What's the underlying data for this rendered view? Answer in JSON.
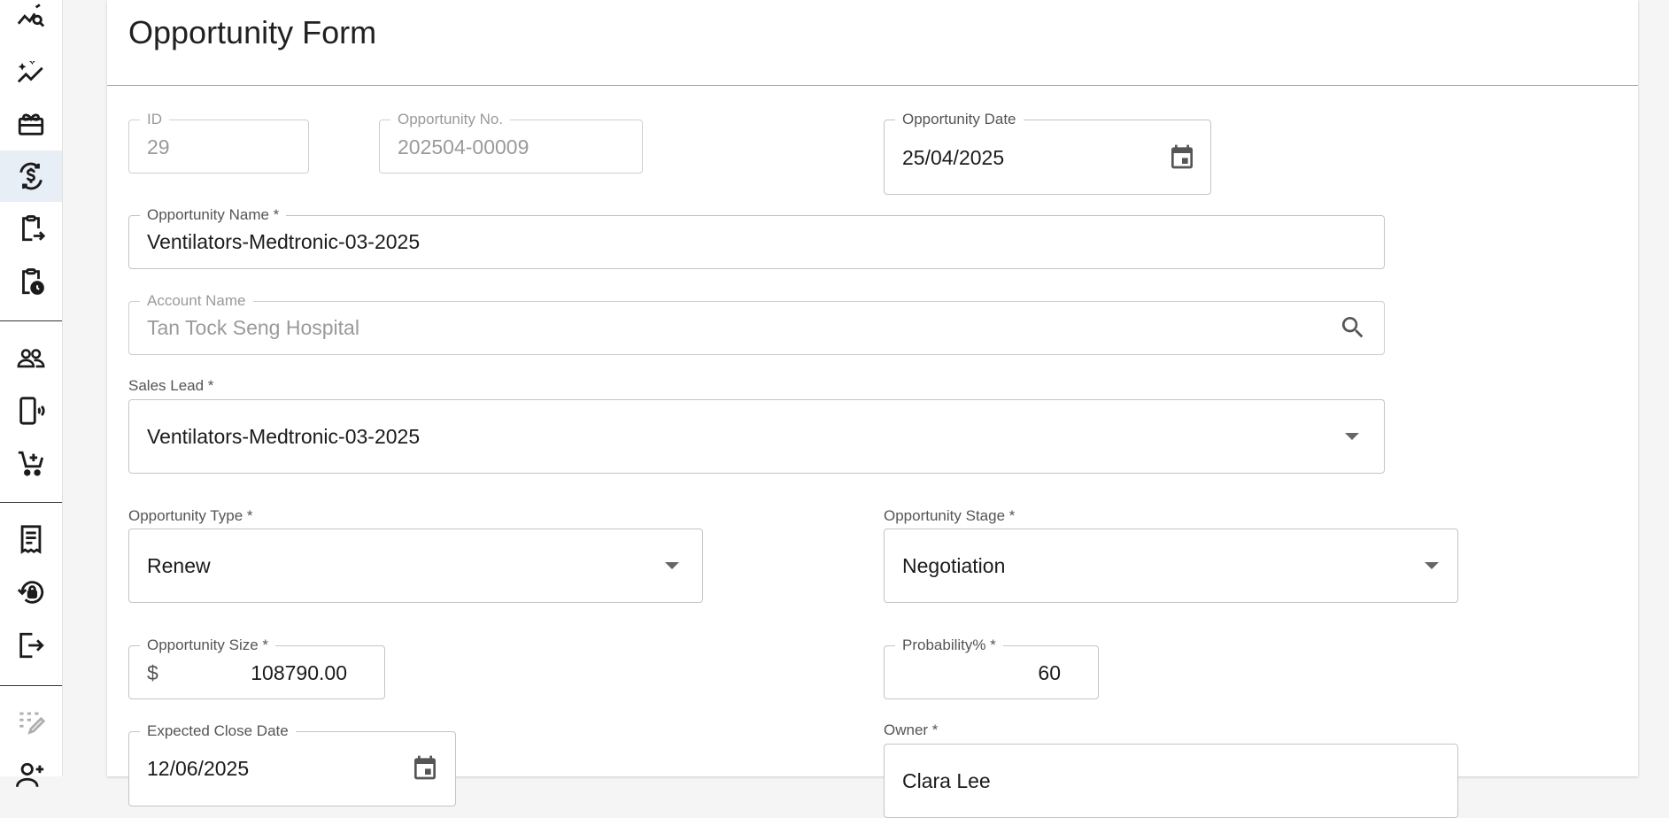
{
  "sidebar": {
    "items": [
      {
        "icon": "trending-search-icon"
      },
      {
        "icon": "insights-sparkle-icon"
      },
      {
        "icon": "gift-card-icon"
      },
      {
        "icon": "currency-exchange-icon",
        "active": true
      },
      {
        "icon": "clipboard-arrow-icon"
      },
      {
        "icon": "clipboard-clock-icon"
      },
      {
        "icon": "people-icon"
      },
      {
        "icon": "phone-vibrate-icon"
      },
      {
        "icon": "add-shopping-cart-icon"
      },
      {
        "icon": "receipt-icon"
      },
      {
        "icon": "lock-reset-icon"
      },
      {
        "icon": "logout-icon"
      },
      {
        "icon": "edit-grid-icon"
      },
      {
        "icon": "person-add-icon"
      }
    ]
  },
  "form": {
    "title": "Opportunity Form",
    "id": {
      "label": "ID",
      "value": "29"
    },
    "opportunity_no": {
      "label": "Opportunity No.",
      "value": "202504-00009"
    },
    "opportunity_date": {
      "label": "Opportunity Date",
      "value": "25/04/2025"
    },
    "opportunity_name": {
      "label": "Opportunity Name *",
      "value": "Ventilators-Medtronic-03-2025"
    },
    "account_name": {
      "label": "Account Name",
      "value": "Tan Tock Seng Hospital"
    },
    "sales_lead": {
      "label": "Sales Lead *",
      "value": "Ventilators-Medtronic-03-2025"
    },
    "opportunity_type": {
      "label": "Opportunity Type *",
      "value": "Renew"
    },
    "opportunity_stage": {
      "label": "Opportunity Stage *",
      "value": "Negotiation"
    },
    "opportunity_size": {
      "label": "Opportunity Size *",
      "prefix": "$",
      "value": "108790.00"
    },
    "probability": {
      "label": "Probability% *",
      "value": "60"
    },
    "expected_close_date": {
      "label": "Expected Close Date",
      "value": "12/06/2025"
    },
    "owner": {
      "label": "Owner *",
      "value": "Clara Lee"
    }
  }
}
